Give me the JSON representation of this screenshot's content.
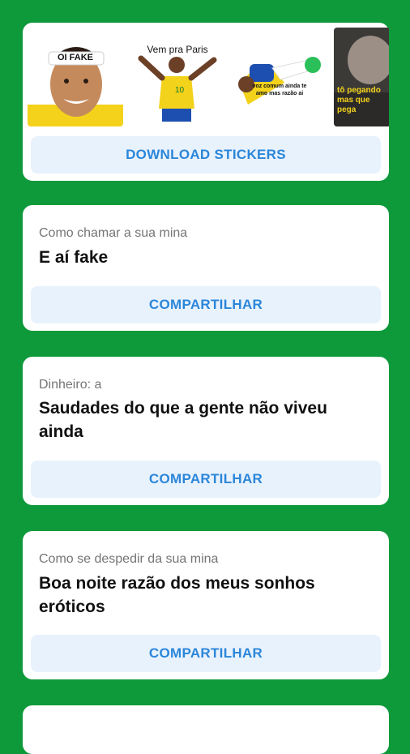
{
  "sticker_pack": {
    "stickers": [
      {
        "caption": "OI FAKE"
      },
      {
        "caption": "Vem pra Paris"
      },
      {
        "caption": "voz comum ainda te amo mas razão ai"
      },
      {
        "caption": "tô pegando mas que pega"
      }
    ],
    "download_label": "DOWNLOAD STICKERS"
  },
  "cards": [
    {
      "label": "Como chamar a sua mina",
      "title": "E aí fake",
      "button": "COMPARTILHAR"
    },
    {
      "label": "Dinheiro: a",
      "title": "Saudades do que a gente não viveu ainda",
      "button": "COMPARTILHAR"
    },
    {
      "label": "Como se despedir da sua mina",
      "title": "Boa noite razão dos meus sonhos eróticos",
      "button": "COMPARTILHAR"
    }
  ],
  "colors": {
    "background": "#0e9a3a",
    "button_text": "#2b86d9",
    "button_bg": "#e8f2fd"
  }
}
